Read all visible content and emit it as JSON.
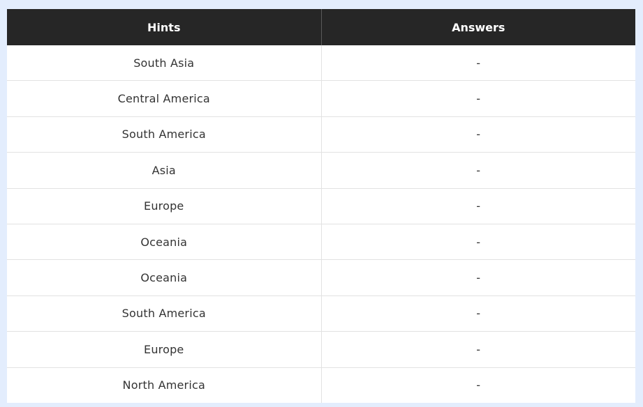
{
  "table": {
    "headers": [
      "Hints",
      "Answers"
    ],
    "rows": [
      {
        "hint": "South Asia",
        "answer": "-"
      },
      {
        "hint": "Central America",
        "answer": "-"
      },
      {
        "hint": "South America",
        "answer": "-"
      },
      {
        "hint": "Asia",
        "answer": "-"
      },
      {
        "hint": "Europe",
        "answer": "-"
      },
      {
        "hint": "Oceania",
        "answer": "-"
      },
      {
        "hint": "Oceania",
        "answer": "-"
      },
      {
        "hint": "South America",
        "answer": "-"
      },
      {
        "hint": "Europe",
        "answer": "-"
      },
      {
        "hint": "North America",
        "answer": "-"
      }
    ]
  }
}
